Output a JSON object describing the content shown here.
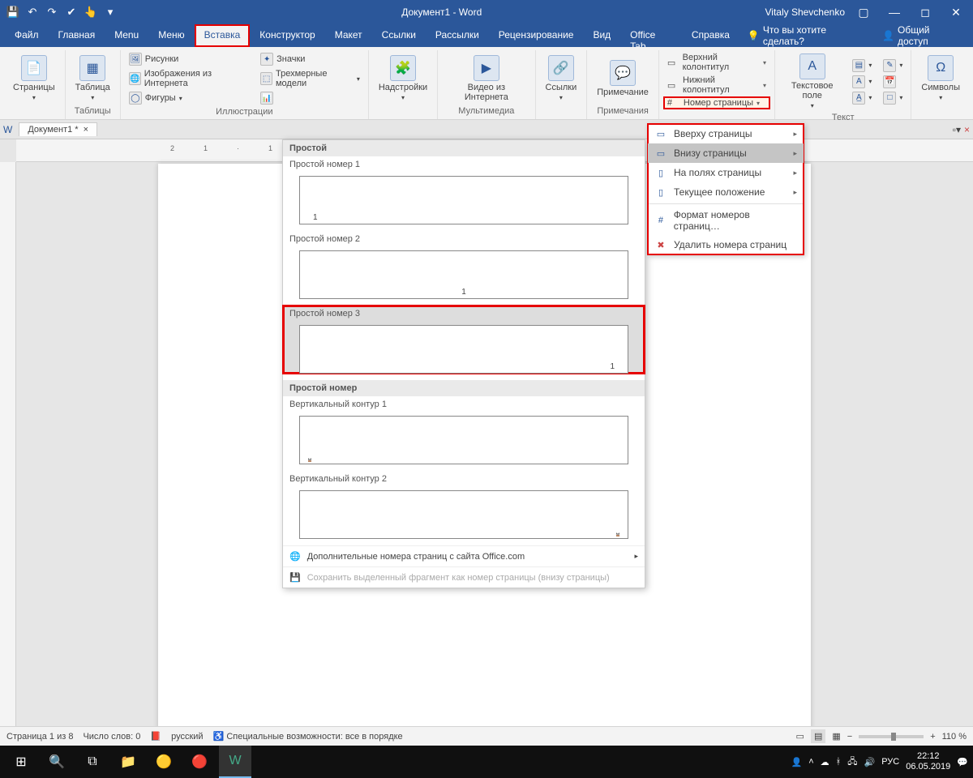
{
  "titlebar": {
    "title": "Документ1 - Word",
    "user": "Vitaly Shevchenko"
  },
  "tabs": [
    "Файл",
    "Главная",
    "Menu",
    "Меню",
    "Вставка",
    "Конструктор",
    "Макет",
    "Ссылки",
    "Рассылки",
    "Рецензирование",
    "Вид",
    "Office Tab",
    "Справка"
  ],
  "active_tab_index": 4,
  "tell_me": "Что вы хотите сделать?",
  "share": "Общий доступ",
  "ribbon": {
    "pages": "Страницы",
    "tables": {
      "btn": "Таблица",
      "title": "Таблицы"
    },
    "illust": {
      "title": "Иллюстрации",
      "items": [
        "Рисунки",
        "Изображения из Интернета",
        "Фигуры",
        "Значки",
        "Трехмерные модели"
      ]
    },
    "addins": {
      "btn": "Надстройки"
    },
    "media": {
      "btn": "Видео из Интернета",
      "title": "Мультимедиа"
    },
    "links": "Ссылки",
    "comment": {
      "btn": "Примечание",
      "title": "Примечания"
    },
    "hf": {
      "header": "Верхний колонтитул",
      "footer": "Нижний колонтитул",
      "pagenum": "Номер страницы"
    },
    "text": {
      "btn": "Текстовое поле",
      "title": "Текст"
    },
    "symbols": "Символы"
  },
  "document_tab": "Документ1 *",
  "pagenum_menu": {
    "top": "Вверху страницы",
    "bottom": "Внизу страницы",
    "margins": "На полях страницы",
    "current": "Текущее положение",
    "format": "Формат номеров страниц…",
    "remove": "Удалить номера страниц"
  },
  "gallery": {
    "cat1": "Простой",
    "opt1": "Простой номер 1",
    "opt2": "Простой номер 2",
    "opt3": "Простой номер 3",
    "cat2": "Простой номер",
    "opt4": "Вертикальный контур 1",
    "opt5": "Вертикальный контур 2",
    "more": "Дополнительные номера страниц с сайта Office.com",
    "save": "Сохранить выделенный фрагмент как номер страницы (внизу страницы)",
    "sample": "1"
  },
  "status": {
    "page": "Страница 1 из 8",
    "words": "Число слов: 0",
    "lang": "русский",
    "access": "Специальные возможности: все в порядке",
    "zoom": "110 %"
  },
  "taskbar": {
    "lang": "РУС",
    "time": "22:12",
    "date": "06.05.2019"
  }
}
